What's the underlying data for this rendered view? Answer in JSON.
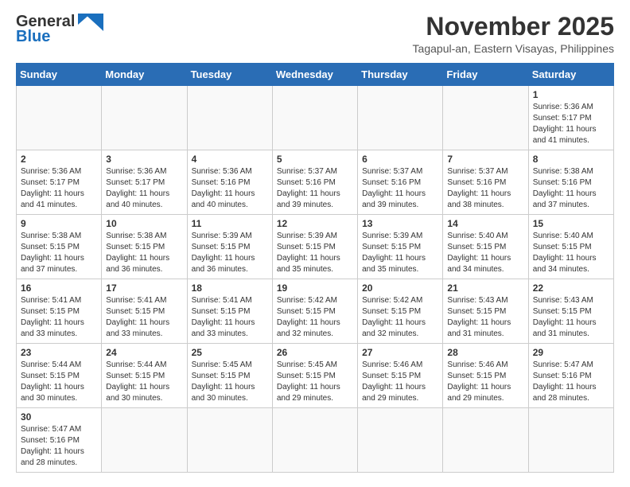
{
  "header": {
    "logo_general": "General",
    "logo_blue": "Blue",
    "month_title": "November 2025",
    "location": "Tagapul-an, Eastern Visayas, Philippines"
  },
  "weekdays": [
    "Sunday",
    "Monday",
    "Tuesday",
    "Wednesday",
    "Thursday",
    "Friday",
    "Saturday"
  ],
  "weeks": [
    [
      {
        "day": "",
        "info": ""
      },
      {
        "day": "",
        "info": ""
      },
      {
        "day": "",
        "info": ""
      },
      {
        "day": "",
        "info": ""
      },
      {
        "day": "",
        "info": ""
      },
      {
        "day": "",
        "info": ""
      },
      {
        "day": "1",
        "info": "Sunrise: 5:36 AM\nSunset: 5:17 PM\nDaylight: 11 hours\nand 41 minutes."
      }
    ],
    [
      {
        "day": "2",
        "info": "Sunrise: 5:36 AM\nSunset: 5:17 PM\nDaylight: 11 hours\nand 41 minutes."
      },
      {
        "day": "3",
        "info": "Sunrise: 5:36 AM\nSunset: 5:17 PM\nDaylight: 11 hours\nand 40 minutes."
      },
      {
        "day": "4",
        "info": "Sunrise: 5:36 AM\nSunset: 5:16 PM\nDaylight: 11 hours\nand 40 minutes."
      },
      {
        "day": "5",
        "info": "Sunrise: 5:37 AM\nSunset: 5:16 PM\nDaylight: 11 hours\nand 39 minutes."
      },
      {
        "day": "6",
        "info": "Sunrise: 5:37 AM\nSunset: 5:16 PM\nDaylight: 11 hours\nand 39 minutes."
      },
      {
        "day": "7",
        "info": "Sunrise: 5:37 AM\nSunset: 5:16 PM\nDaylight: 11 hours\nand 38 minutes."
      },
      {
        "day": "8",
        "info": "Sunrise: 5:38 AM\nSunset: 5:16 PM\nDaylight: 11 hours\nand 37 minutes."
      }
    ],
    [
      {
        "day": "9",
        "info": "Sunrise: 5:38 AM\nSunset: 5:15 PM\nDaylight: 11 hours\nand 37 minutes."
      },
      {
        "day": "10",
        "info": "Sunrise: 5:38 AM\nSunset: 5:15 PM\nDaylight: 11 hours\nand 36 minutes."
      },
      {
        "day": "11",
        "info": "Sunrise: 5:39 AM\nSunset: 5:15 PM\nDaylight: 11 hours\nand 36 minutes."
      },
      {
        "day": "12",
        "info": "Sunrise: 5:39 AM\nSunset: 5:15 PM\nDaylight: 11 hours\nand 35 minutes."
      },
      {
        "day": "13",
        "info": "Sunrise: 5:39 AM\nSunset: 5:15 PM\nDaylight: 11 hours\nand 35 minutes."
      },
      {
        "day": "14",
        "info": "Sunrise: 5:40 AM\nSunset: 5:15 PM\nDaylight: 11 hours\nand 34 minutes."
      },
      {
        "day": "15",
        "info": "Sunrise: 5:40 AM\nSunset: 5:15 PM\nDaylight: 11 hours\nand 34 minutes."
      }
    ],
    [
      {
        "day": "16",
        "info": "Sunrise: 5:41 AM\nSunset: 5:15 PM\nDaylight: 11 hours\nand 33 minutes."
      },
      {
        "day": "17",
        "info": "Sunrise: 5:41 AM\nSunset: 5:15 PM\nDaylight: 11 hours\nand 33 minutes."
      },
      {
        "day": "18",
        "info": "Sunrise: 5:41 AM\nSunset: 5:15 PM\nDaylight: 11 hours\nand 33 minutes."
      },
      {
        "day": "19",
        "info": "Sunrise: 5:42 AM\nSunset: 5:15 PM\nDaylight: 11 hours\nand 32 minutes."
      },
      {
        "day": "20",
        "info": "Sunrise: 5:42 AM\nSunset: 5:15 PM\nDaylight: 11 hours\nand 32 minutes."
      },
      {
        "day": "21",
        "info": "Sunrise: 5:43 AM\nSunset: 5:15 PM\nDaylight: 11 hours\nand 31 minutes."
      },
      {
        "day": "22",
        "info": "Sunrise: 5:43 AM\nSunset: 5:15 PM\nDaylight: 11 hours\nand 31 minutes."
      }
    ],
    [
      {
        "day": "23",
        "info": "Sunrise: 5:44 AM\nSunset: 5:15 PM\nDaylight: 11 hours\nand 30 minutes."
      },
      {
        "day": "24",
        "info": "Sunrise: 5:44 AM\nSunset: 5:15 PM\nDaylight: 11 hours\nand 30 minutes."
      },
      {
        "day": "25",
        "info": "Sunrise: 5:45 AM\nSunset: 5:15 PM\nDaylight: 11 hours\nand 30 minutes."
      },
      {
        "day": "26",
        "info": "Sunrise: 5:45 AM\nSunset: 5:15 PM\nDaylight: 11 hours\nand 29 minutes."
      },
      {
        "day": "27",
        "info": "Sunrise: 5:46 AM\nSunset: 5:15 PM\nDaylight: 11 hours\nand 29 minutes."
      },
      {
        "day": "28",
        "info": "Sunrise: 5:46 AM\nSunset: 5:15 PM\nDaylight: 11 hours\nand 29 minutes."
      },
      {
        "day": "29",
        "info": "Sunrise: 5:47 AM\nSunset: 5:16 PM\nDaylight: 11 hours\nand 28 minutes."
      }
    ],
    [
      {
        "day": "30",
        "info": "Sunrise: 5:47 AM\nSunset: 5:16 PM\nDaylight: 11 hours\nand 28 minutes."
      },
      {
        "day": "",
        "info": ""
      },
      {
        "day": "",
        "info": ""
      },
      {
        "day": "",
        "info": ""
      },
      {
        "day": "",
        "info": ""
      },
      {
        "day": "",
        "info": ""
      },
      {
        "day": "",
        "info": ""
      }
    ]
  ]
}
